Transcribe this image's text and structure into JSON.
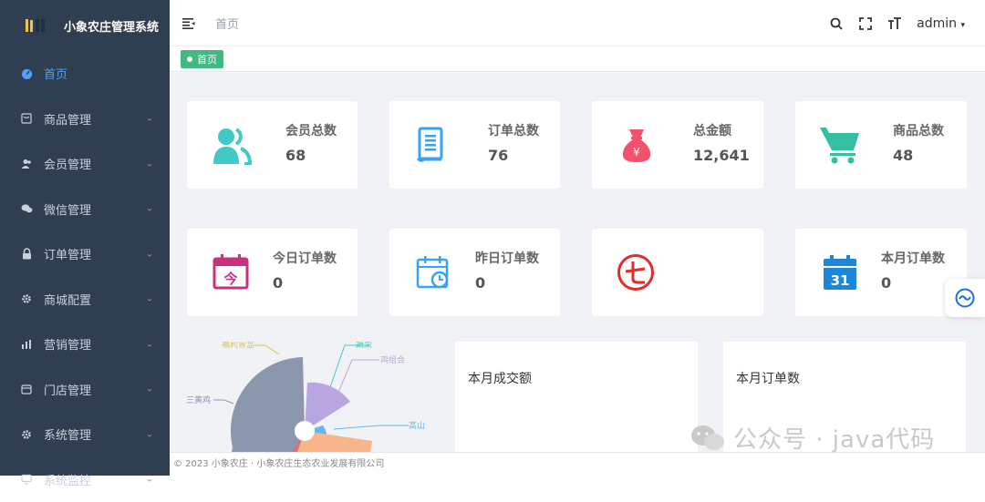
{
  "app": {
    "title": "小象农庄管理系统"
  },
  "sidebar": {
    "items": [
      {
        "label": "首页",
        "icon": "dashboard-icon",
        "active": true
      },
      {
        "label": "商品管理",
        "icon": "product-icon"
      },
      {
        "label": "会员管理",
        "icon": "member-icon"
      },
      {
        "label": "微信管理",
        "icon": "wechat-icon"
      },
      {
        "label": "订单管理",
        "icon": "lock-icon"
      },
      {
        "label": "商城配置",
        "icon": "gear-icon"
      },
      {
        "label": "营销管理",
        "icon": "chart-icon"
      },
      {
        "label": "门店管理",
        "icon": "store-icon"
      },
      {
        "label": "系统管理",
        "icon": "gear-icon"
      },
      {
        "label": "系统监控",
        "icon": "monitor-icon"
      }
    ]
  },
  "header": {
    "breadcrumb": "首页",
    "user": "admin"
  },
  "tabs": [
    {
      "label": "首页",
      "color": "#42b983"
    }
  ],
  "stats": {
    "row1": [
      {
        "title": "会员总数",
        "value": "68",
        "icon": "members-icon",
        "color": "#40c9c6"
      },
      {
        "title": "订单总数",
        "value": "76",
        "icon": "document-icon",
        "color": "#36a3f7"
      },
      {
        "title": "总金额",
        "value": "12,641",
        "icon": "money-bag-icon",
        "color": "#f4516c"
      },
      {
        "title": "商品总数",
        "value": "48",
        "icon": "cart-icon",
        "color": "#34bfa3"
      }
    ],
    "row2": [
      {
        "title": "今日订单数",
        "value": "0",
        "icon": "calendar-today-icon",
        "color": "#c9307e"
      },
      {
        "title": "昨日订单数",
        "value": "0",
        "icon": "calendar-clock-icon",
        "color": "#36a3f7"
      },
      {
        "title": "",
        "value": "",
        "icon": "seven-icon",
        "color": "#e22b2b"
      },
      {
        "title": "本月订单数",
        "value": "0",
        "icon": "calendar-31-icon",
        "color": "#1e86d8",
        "badge": "31"
      }
    ]
  },
  "charts": {
    "pie_labels": [
      "福利盲盒",
      "蔬菜",
      "鸡组合",
      "三黄鸡",
      "高山"
    ],
    "monthly_sales_title": "本月成交额",
    "monthly_orders_title": "本月订单数"
  },
  "chart_data": {
    "type": "pie",
    "categories": [
      "福利盲盒",
      "蔬菜",
      "鸡组合",
      "三黄鸡",
      "高山"
    ],
    "values": [],
    "title": ""
  },
  "footer": {
    "text": "© 2023 小象农庄 · 小象农庄生态农业发展有限公司"
  },
  "watermark": {
    "text": "公众号 · java代码"
  }
}
